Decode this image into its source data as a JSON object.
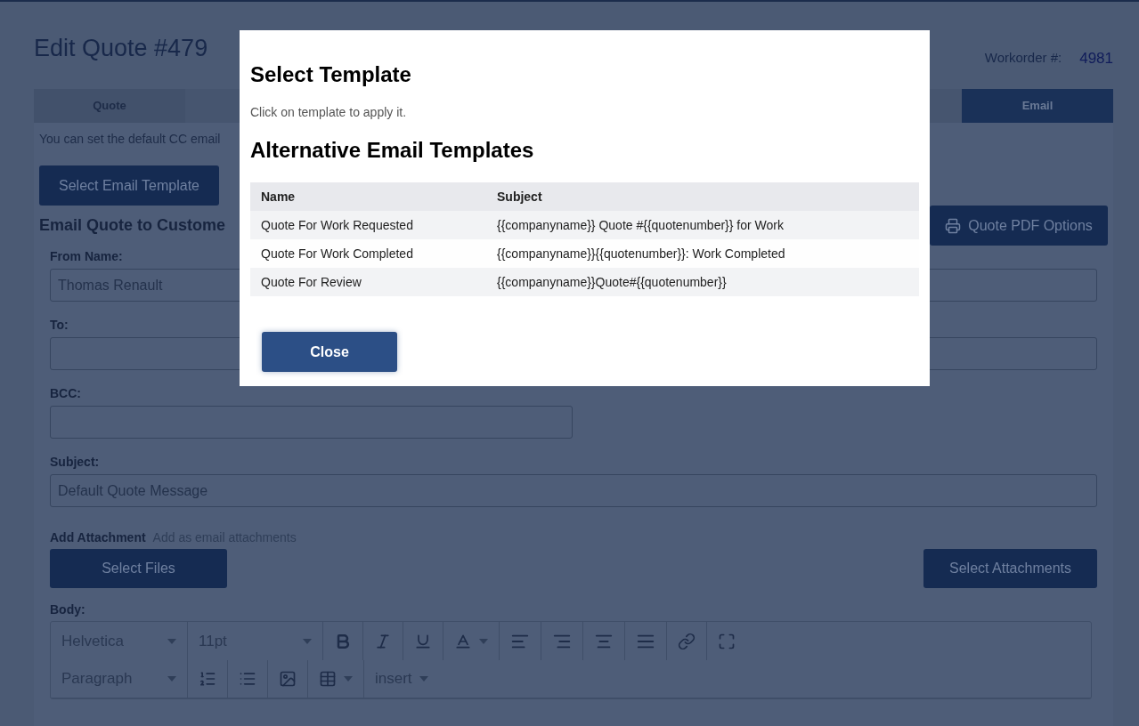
{
  "page": {
    "title": "Edit Quote #479",
    "workorder_label": "Workorder #:",
    "workorder_value": "4981"
  },
  "tabs": [
    {
      "label": "Quote",
      "selected": false
    },
    {
      "label": "Email",
      "selected": true
    }
  ],
  "info_text": "You can set the default CC email",
  "select_template_button": "Select Email Template",
  "section_title": "Email Quote to Custome",
  "pdf_button": "Quote PDF Options",
  "fields": [
    {
      "label": "From Name:",
      "value": "Thomas Renault",
      "kind": "full"
    },
    {
      "label": "To:",
      "kind": "full"
    },
    {
      "label": "BCC:",
      "kind": "half"
    },
    {
      "label": "Subject:",
      "value": "Default Quote Message",
      "kind": "full"
    }
  ],
  "attachment": {
    "label": "Add Attachment",
    "hint": "Add as email attachments",
    "select_files": "Select Files",
    "select_attachments": "Select Attachments"
  },
  "body": {
    "label": "Body:",
    "font": "Helvetica",
    "size": "11pt",
    "block": "Paragraph",
    "insert": "insert"
  },
  "modal": {
    "title": "Select Template",
    "hint": "Click on template to apply it.",
    "subtitle": "Alternative Email Templates",
    "columns": [
      "Name",
      "Subject"
    ],
    "rows": [
      {
        "name": "Quote For Work Requested",
        "subject": "{{companyname}} Quote #{{quotenumber}} for Work"
      },
      {
        "name": "Quote For Work Completed",
        "subject": "{{companyname}}{{quotenumber}}: Work Completed"
      },
      {
        "name": "Quote For Review",
        "subject": "{{companyname}}Quote#{{quotenumber}}"
      }
    ],
    "close": "Close"
  }
}
